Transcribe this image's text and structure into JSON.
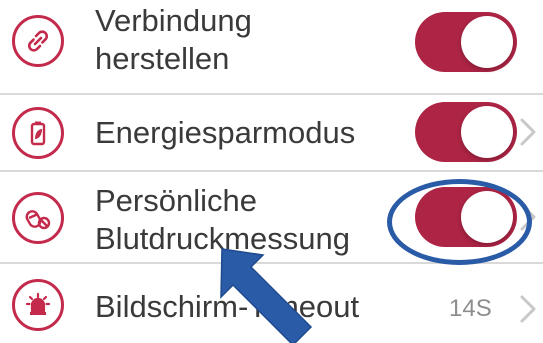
{
  "settings": {
    "items": [
      {
        "label": "Verbindung\nherstellen",
        "icon": "link-icon",
        "toggle": "on"
      },
      {
        "label": "Energiesparmodus",
        "icon": "battery-leaf-icon",
        "toggle": "on"
      },
      {
        "label": "Persönliche\nBlutdruckmessung",
        "icon": "pills-icon",
        "toggle": "on"
      },
      {
        "label": "Bildschirm-Timeout",
        "icon": "alarm-light-icon",
        "value": "14S"
      }
    ]
  },
  "colors": {
    "accent": "#ad2445",
    "icon_ring": "#c42a4b",
    "annotation": "#2a5ba7"
  }
}
